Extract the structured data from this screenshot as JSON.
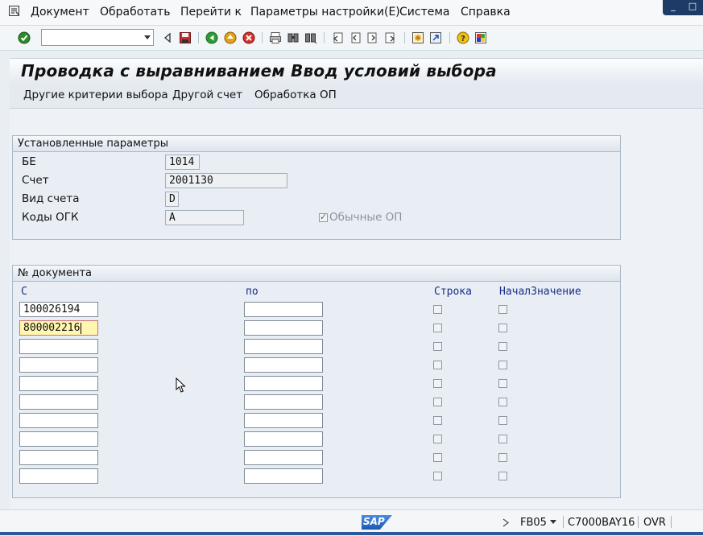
{
  "menu": {
    "items": [
      "Документ",
      "Обработать",
      "Перейти к",
      "Параметры настройки(E)",
      "Система",
      "Справка"
    ]
  },
  "window_controls": {
    "minimize": "_",
    "close": "□"
  },
  "toolbar": {
    "command_value": "",
    "icons": [
      "enter-icon",
      "back-icon",
      "save-icon",
      "green-back-icon",
      "exit-icon",
      "cancel-icon",
      "print-icon",
      "find-icon",
      "find-next-icon",
      "first-page-icon",
      "prev-page-icon",
      "next-page-icon",
      "last-page-icon",
      "new-session-icon",
      "shortcut-icon",
      "help-icon",
      "layout-icon"
    ]
  },
  "title": "Проводка с выравниванием Ввод условий выбора",
  "app_toolbar": {
    "btn1": "Другие критерии выбора",
    "btn2": "Другой счет",
    "btn3": "Обработка ОП"
  },
  "params": {
    "header": "Установленные параметры",
    "company_label": "БЕ",
    "company_value": "1014",
    "account_label": "Счет",
    "account_value": "2001130",
    "account_type_label": "Вид счета",
    "account_type_value": "D",
    "sgl_label": "Коды ОГК",
    "sgl_value": "A",
    "normal_items_label": "Обычные ОП",
    "normal_items_checked": true
  },
  "documents": {
    "header": "№ документа",
    "col_from": "С",
    "col_to": "по",
    "col_line": "Строка",
    "col_initial": "НачалЗначение",
    "rows": [
      {
        "from": "100026194",
        "to": ""
      },
      {
        "from": "800002216",
        "to": ""
      },
      {
        "from": "",
        "to": ""
      },
      {
        "from": "",
        "to": ""
      },
      {
        "from": "",
        "to": ""
      },
      {
        "from": "",
        "to": ""
      },
      {
        "from": "",
        "to": ""
      },
      {
        "from": "",
        "to": ""
      },
      {
        "from": "",
        "to": ""
      },
      {
        "from": "",
        "to": ""
      }
    ]
  },
  "status": {
    "tcode": "FB05",
    "system": "C7000BAY16",
    "mode": "OVR"
  },
  "colors": {
    "accent": "#1d3b66",
    "focus_field": "#fff6b0",
    "column_header": "#1a2e8a"
  }
}
